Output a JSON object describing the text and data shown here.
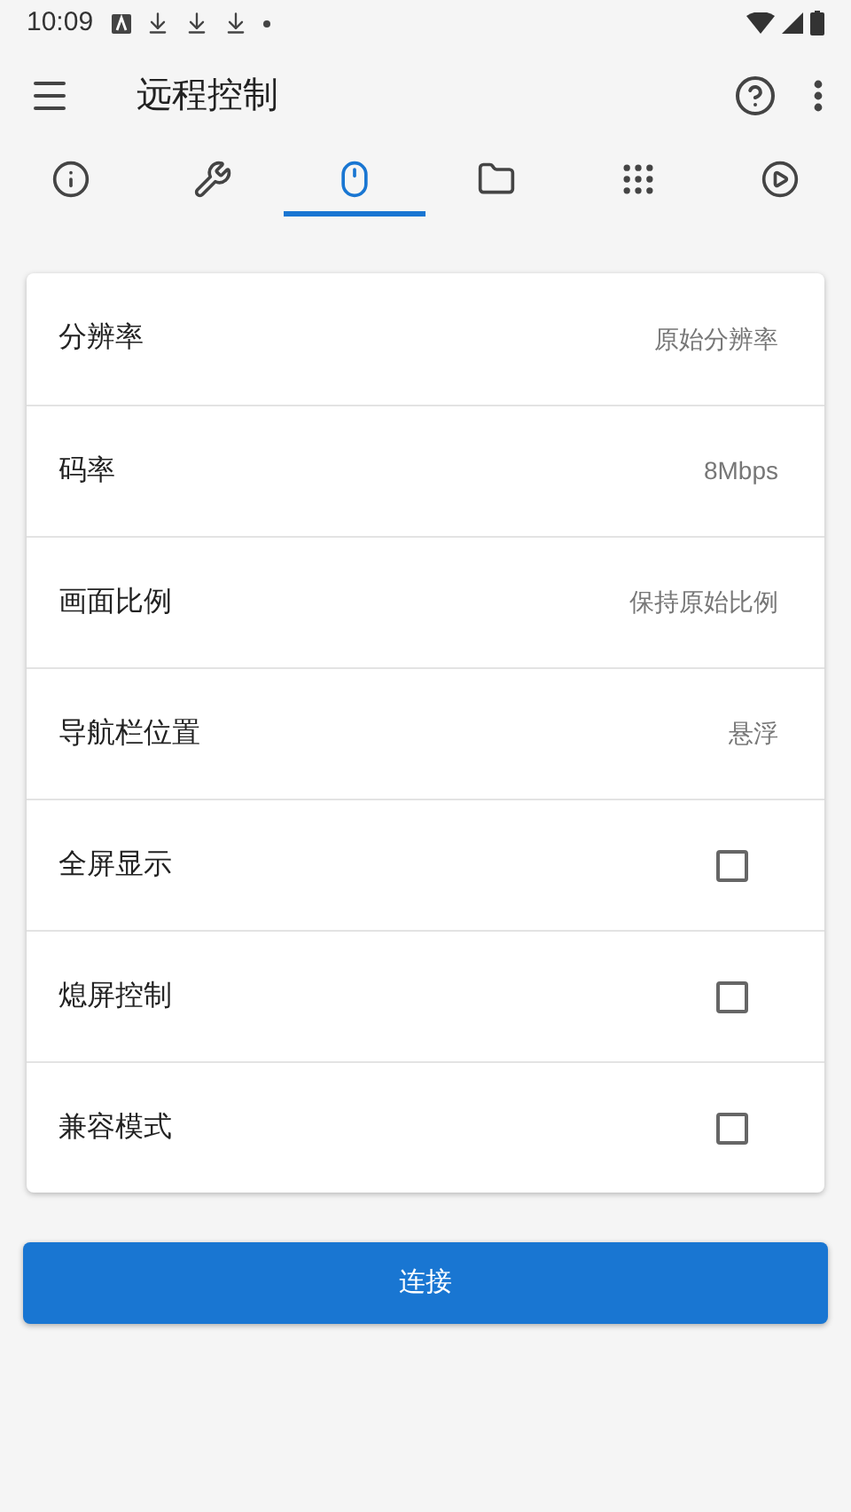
{
  "status_bar": {
    "time": "10:09"
  },
  "toolbar": {
    "title": "远程控制"
  },
  "tabs": [
    {
      "kind": "info",
      "selected": false
    },
    {
      "kind": "tools",
      "selected": false
    },
    {
      "kind": "mouse",
      "selected": true
    },
    {
      "kind": "folder",
      "selected": false
    },
    {
      "kind": "apps",
      "selected": false
    },
    {
      "kind": "play",
      "selected": false
    }
  ],
  "settings": [
    {
      "kind": "value",
      "label": "分辨率",
      "value": "原始分辨率"
    },
    {
      "kind": "value",
      "label": "码率",
      "value": "8Mbps"
    },
    {
      "kind": "value",
      "label": "画面比例",
      "value": "保持原始比例"
    },
    {
      "kind": "value",
      "label": "导航栏位置",
      "value": "悬浮"
    },
    {
      "kind": "checkbox",
      "label": "全屏显示",
      "checked": false
    },
    {
      "kind": "checkbox",
      "label": "熄屏控制",
      "checked": false
    },
    {
      "kind": "checkbox",
      "label": "兼容模式",
      "checked": false
    }
  ],
  "connect_button": "连接"
}
